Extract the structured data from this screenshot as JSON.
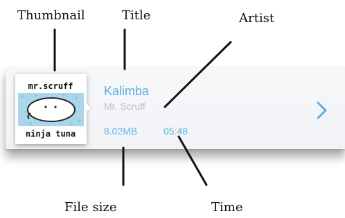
{
  "callouts": {
    "thumbnail": "Thumbnail",
    "title": "Title",
    "artist": "Artist",
    "file_size": "File size",
    "time": "Time"
  },
  "track": {
    "title": "Kalimba",
    "artist": "Mr. Scruff",
    "file_size": "8.02MB",
    "duration": "05:48"
  },
  "album_art": {
    "top_text": "mr.scruff",
    "bottom_text": "ninja tuna"
  },
  "icons": {
    "detail_chevron": "chevron-right-icon"
  },
  "colors": {
    "accent": "#5aaee6",
    "secondary_text": "#b7bcc3",
    "card_background": "#f3f5f7"
  }
}
